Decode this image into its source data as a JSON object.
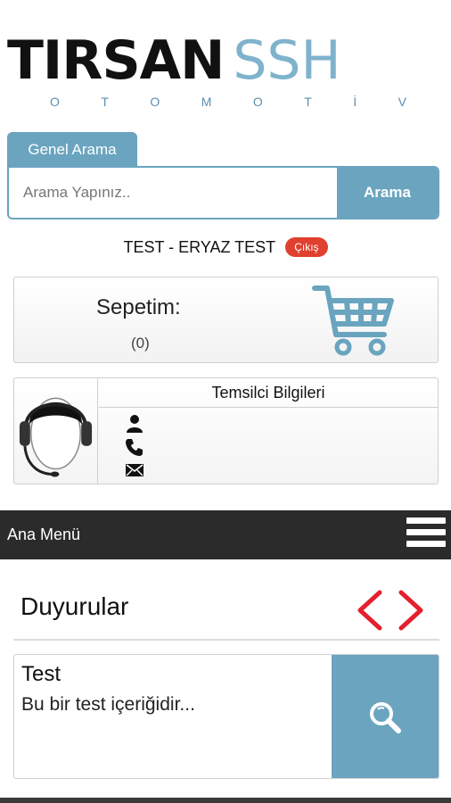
{
  "logo": {
    "brand_main": "TIRSAN",
    "brand_accent": "SSH",
    "subtitle_letters": [
      "O",
      "T",
      "O",
      "M",
      "O",
      "T",
      "İ",
      "V"
    ]
  },
  "search": {
    "tab_label": "Genel Arama",
    "placeholder": "Arama Yapınız..",
    "button_label": "Arama"
  },
  "user": {
    "name": "TEST - ERYAZ TEST",
    "logout_label": "Çıkış"
  },
  "cart": {
    "title": "Sepetim:",
    "count": "(0)"
  },
  "representative": {
    "title": "Temsilci Bilgileri",
    "fields": [
      "person-icon",
      "phone-icon",
      "mail-icon"
    ]
  },
  "menu": {
    "label": "Ana Menü"
  },
  "announcements": {
    "title": "Duyurular",
    "items": [
      {
        "title": "Test",
        "text": "Bu bir test içeriğidir..."
      }
    ]
  },
  "colors": {
    "accent": "#6aa4bf",
    "logout": "#e0402f",
    "arrows": "#e4202e",
    "menu_bar": "#2b2b2b"
  }
}
